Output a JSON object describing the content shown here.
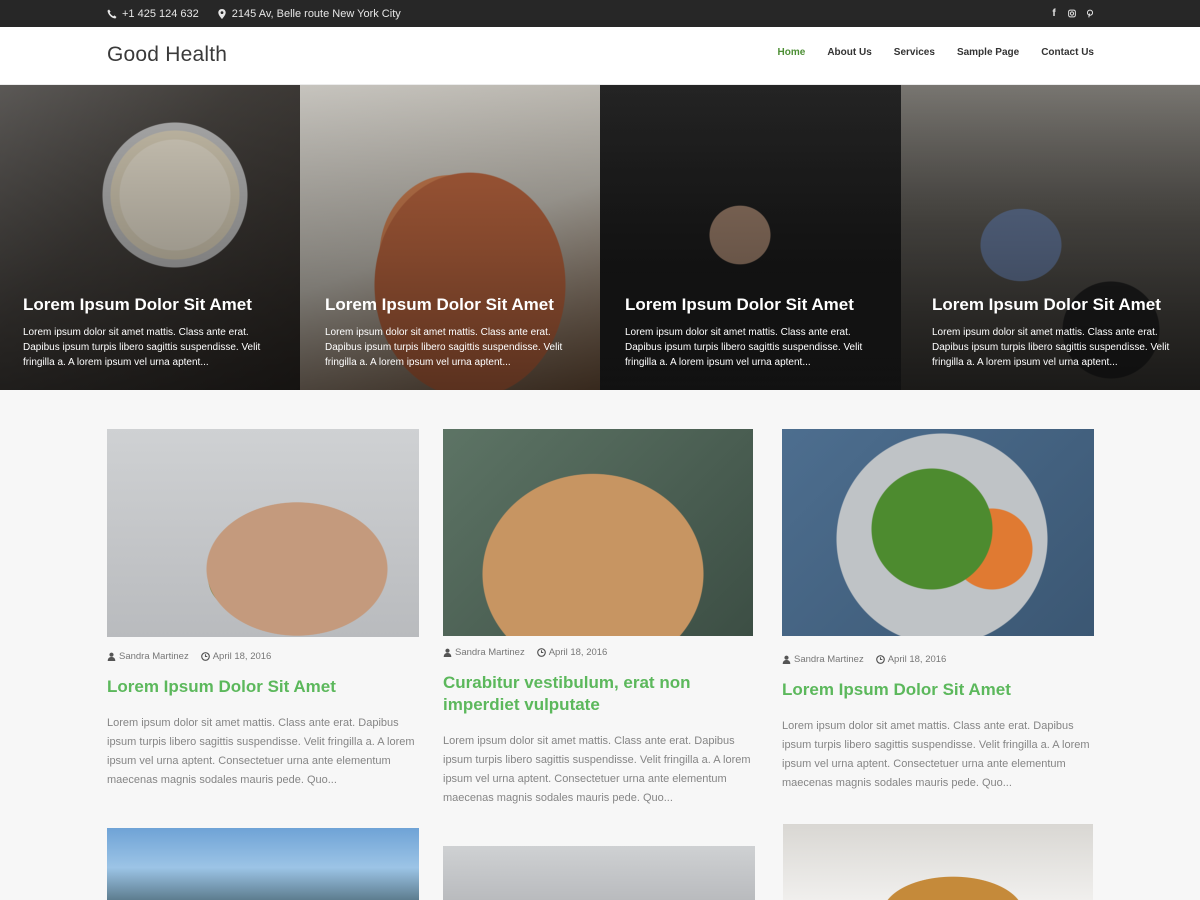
{
  "topbar": {
    "phone": "+1 425 124 632",
    "address": "2145 Av, Belle route New York City",
    "social": [
      "facebook-icon",
      "instagram-icon",
      "pinterest-icon"
    ]
  },
  "header": {
    "brand": "Good Health",
    "nav": [
      "Home",
      "About Us",
      "Services",
      "Sample Page",
      "Contact Us"
    ],
    "active_nav": "Home"
  },
  "slider": [
    {
      "title": "Lorem Ipsum Dolor Sit Amet",
      "excerpt": "Lorem ipsum dolor sit amet mattis. Class ante erat. Dapibus ipsum turpis libero sagittis suspendisse. Velit fringilla a. A lorem ipsum vel urna aptent..."
    },
    {
      "title": "Lorem Ipsum Dolor Sit Amet",
      "excerpt": "Lorem ipsum dolor sit amet mattis. Class ante erat. Dapibus ipsum turpis libero sagittis suspendisse. Velit fringilla a. A lorem ipsum vel urna aptent..."
    },
    {
      "title": "Lorem Ipsum Dolor Sit Amet",
      "excerpt": "Lorem ipsum dolor sit amet mattis. Class ante erat. Dapibus ipsum turpis libero sagittis suspendisse. Velit fringilla a. A lorem ipsum vel urna aptent..."
    },
    {
      "title": "Lorem Ipsum Dolor Sit Amet",
      "excerpt": "Lorem ipsum dolor sit amet mattis. Class ante erat. Dapibus ipsum turpis libero sagittis suspendisse. Velit fringilla a. A lorem ipsum vel urna aptent..."
    }
  ],
  "posts": [
    {
      "author": "Sandra Martinez",
      "date": "April 18, 2016",
      "title": "Lorem Ipsum Dolor Sit Amet",
      "excerpt": "Lorem ipsum dolor sit amet mattis. Class ante erat. Dapibus ipsum turpis libero sagittis suspendisse. Velit fringilla a. A lorem ipsum vel urna aptent. Consectetuer urna ante elementum maecenas magnis sodales mauris pede. Quo..."
    },
    {
      "author": "Sandra Martinez",
      "date": "April 18, 2016",
      "title": "Curabitur vestibulum, erat non imperdiet vulputate",
      "excerpt": "Lorem ipsum dolor sit amet mattis. Class ante erat. Dapibus ipsum turpis libero sagittis suspendisse. Velit fringilla a. A lorem ipsum vel urna aptent. Consectetuer urna ante elementum maecenas magnis sodales mauris pede. Quo..."
    },
    {
      "author": "Sandra Martinez",
      "date": "April 18, 2016",
      "title": "Lorem Ipsum Dolor Sit Amet",
      "excerpt": "Lorem ipsum dolor sit amet mattis. Class ante erat. Dapibus ipsum turpis libero sagittis suspendisse. Velit fringilla a. A lorem ipsum vel urna aptent. Consectetuer urna ante elementum maecenas magnis sodales mauris pede. Quo..."
    }
  ],
  "colors": {
    "accent": "#5cb85c",
    "nav_active": "#4d8f35",
    "topbar": "#272727"
  }
}
